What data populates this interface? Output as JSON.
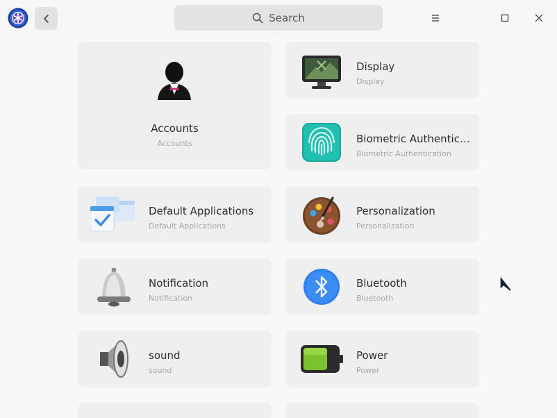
{
  "header": {
    "search_placeholder": "Search"
  },
  "modules": {
    "accounts": {
      "title": "Accounts",
      "subtitle": "Accounts"
    },
    "display": {
      "title": "Display",
      "subtitle": "Display"
    },
    "biometric": {
      "title": "Biometric Authentica…",
      "subtitle": "Biometric Authentication"
    },
    "default_apps": {
      "title": "Default Applications",
      "subtitle": "Default Applications"
    },
    "personalization": {
      "title": "Personalization",
      "subtitle": "Personalization"
    },
    "notification": {
      "title": "Notification",
      "subtitle": "Notification"
    },
    "bluetooth": {
      "title": "Bluetooth",
      "subtitle": "Bluetooth"
    },
    "sound": {
      "title": "sound",
      "subtitle": "sound"
    },
    "power": {
      "title": "Power",
      "subtitle": "Power"
    }
  },
  "icons": {
    "app_logo": "control-center-logo-icon",
    "back": "chevron-left-icon",
    "search": "search-icon",
    "menu": "hamburger-menu-icon",
    "maximize": "maximize-icon",
    "close": "close-icon"
  },
  "colors": {
    "window_bg": "#f7f7f7",
    "card_bg": "#efefef",
    "accent": "#2e7ef0"
  }
}
